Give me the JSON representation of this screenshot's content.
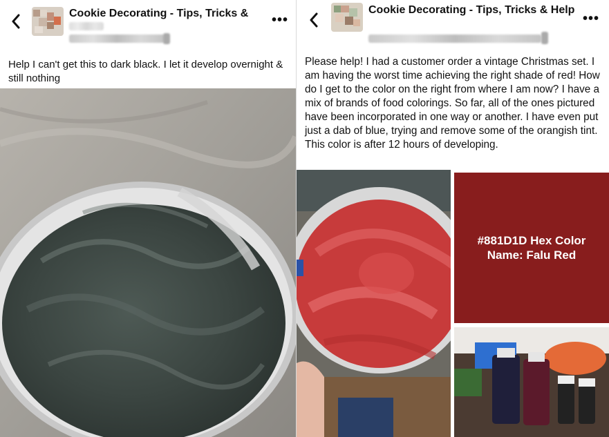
{
  "left_post": {
    "group_title": "Cookie Decorating - Tips, Tricks &",
    "body": "Help I can't get this to dark black. I let it develop overnight & still nothing"
  },
  "right_post": {
    "group_title": "Cookie Decorating - Tips, Tricks & Help",
    "body": "Please help! I had a customer order a vintage Christmas set. I am having the worst time achieving the right shade of red! How do I get to the color on the right from where I am now? I have a mix of brands of food colorings. So far, all of the ones pictured have been incorporated in one way or another. I have even put just a dab of blue, trying and remove some of the orangish tint. This color is after 12 hours of developing.",
    "swatch": {
      "line1": "#881D1D Hex Color",
      "line2": "Name: Falu Red",
      "color": "#881D1D"
    }
  },
  "icons": {
    "back": "chevron-left-icon",
    "more": "more-options-icon"
  }
}
